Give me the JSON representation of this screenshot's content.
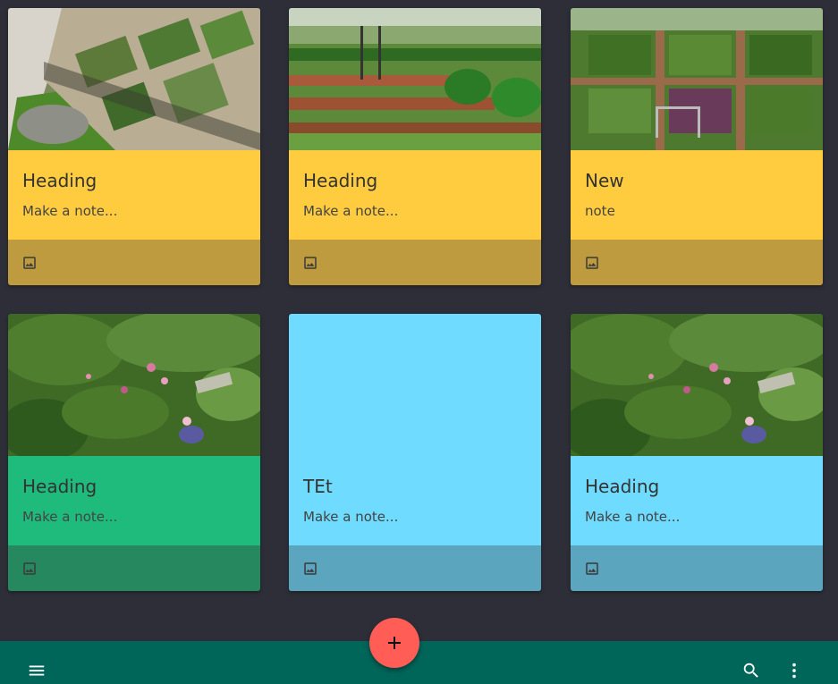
{
  "colors": {
    "background": "#2e2e38",
    "yellow_body": "#ffcc40",
    "yellow_footer": "#bf9b40",
    "green_body": "#1fbb7c",
    "green_footer": "#26885e",
    "cyan_body": "#6fdbff",
    "cyan_footer": "#5ca5bf",
    "fab": "#ff5d55",
    "bottom_bar": "#00665a"
  },
  "cards": [
    {
      "heading": "Heading",
      "note": "Make a note...",
      "has_image": true,
      "image": "garden-raised-beds-photo",
      "color": "yellow"
    },
    {
      "heading": "Heading",
      "note": "Make a note...",
      "has_image": true,
      "image": "formal-vegetable-garden-photo",
      "color": "yellow"
    },
    {
      "heading": "New",
      "note": "note",
      "has_image": true,
      "image": "potager-garden-photo",
      "color": "yellow"
    },
    {
      "heading": "Heading",
      "note": "Make a note...",
      "has_image": true,
      "image": "cottage-flower-garden-photo",
      "color": "green"
    },
    {
      "heading": "TEt",
      "note": "Make a note...",
      "has_image": false,
      "color": "cyan"
    },
    {
      "heading": "Heading",
      "note": "Make a note...",
      "has_image": true,
      "image": "cottage-flower-garden-photo",
      "color": "cyan"
    }
  ],
  "card_footer_icon": "image-icon",
  "fab_icon": "plus-icon",
  "bottom_bar": {
    "left_icon": "menu-icon",
    "right_icons": [
      "search-icon",
      "more-vert-icon"
    ]
  }
}
